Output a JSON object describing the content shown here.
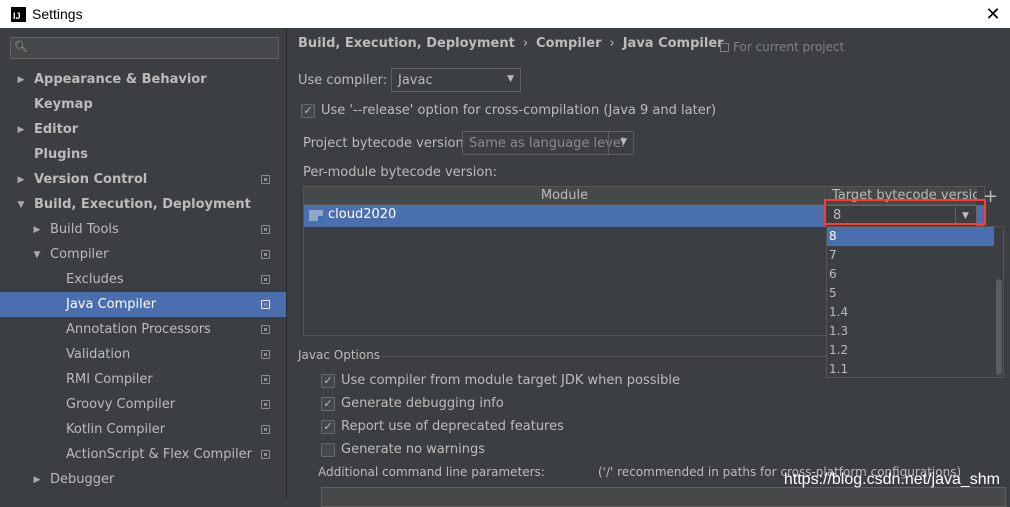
{
  "window": {
    "title": "Settings",
    "app_icon": "IJ",
    "close": "✕"
  },
  "search": {
    "placeholder": "",
    "value": ""
  },
  "sidebar": {
    "items": [
      {
        "label": "Appearance & Behavior",
        "arrow": "▶",
        "bold": true
      },
      {
        "label": "Keymap",
        "arrow": "",
        "bold": true
      },
      {
        "label": "Editor",
        "arrow": "▶",
        "bold": true
      },
      {
        "label": "Plugins",
        "arrow": "",
        "bold": true
      },
      {
        "label": "Version Control",
        "arrow": "▶",
        "bold": true
      },
      {
        "label": "Build, Execution, Deployment",
        "arrow": "▼",
        "bold": true
      },
      {
        "label": "Build Tools",
        "arrow": "▶"
      },
      {
        "label": "Compiler",
        "arrow": "▼"
      },
      {
        "label": "Excludes"
      },
      {
        "label": "Java Compiler",
        "selected": true
      },
      {
        "label": "Annotation Processors"
      },
      {
        "label": "Validation"
      },
      {
        "label": "RMI Compiler"
      },
      {
        "label": "Groovy Compiler"
      },
      {
        "label": "Kotlin Compiler"
      },
      {
        "label": "ActionScript & Flex Compiler"
      },
      {
        "label": "Debugger",
        "arrow": "▶"
      }
    ]
  },
  "breadcrumb": {
    "parts": [
      "Build, Execution, Deployment",
      "Compiler",
      "Java Compiler"
    ],
    "separator": "›"
  },
  "for_current_project": "For current project",
  "use_compiler": {
    "label": "Use compiler:",
    "value": "Javac"
  },
  "release_option": {
    "label": "Use '--release' option for cross-compilation (Java 9 and later)",
    "checked": true
  },
  "project_bytecode": {
    "label": "Project bytecode version:",
    "value": "Same as language level"
  },
  "per_module_label": "Per-module bytecode version:",
  "table": {
    "headers": {
      "module": "Module",
      "target": "Target bytecode version"
    },
    "rows": [
      {
        "module": "cloud2020",
        "target": "8"
      }
    ],
    "add_button": "+"
  },
  "dropdown": {
    "options": [
      "8",
      "7",
      "6",
      "5",
      "1.4",
      "1.3",
      "1.2",
      "1.1"
    ],
    "selected": "8"
  },
  "javac_options": {
    "section_title": "Javac Options",
    "checkboxes": [
      {
        "label": "Use compiler from module target JDK when possible",
        "checked": true
      },
      {
        "label": "Generate debugging info",
        "checked": true
      },
      {
        "label": "Report use of deprecated features",
        "checked": true
      },
      {
        "label": "Generate no warnings",
        "checked": false
      }
    ],
    "additional_params_label": "Additional command line parameters:",
    "additional_params_hint": "('/' recommended in paths for cross-platform configurations)"
  },
  "watermark": "https://blog.csdn.net/java_shm",
  "colors": {
    "selection": "#4b6eaf",
    "background": "#3c3f41",
    "highlight_outline": "#ff3b30"
  }
}
